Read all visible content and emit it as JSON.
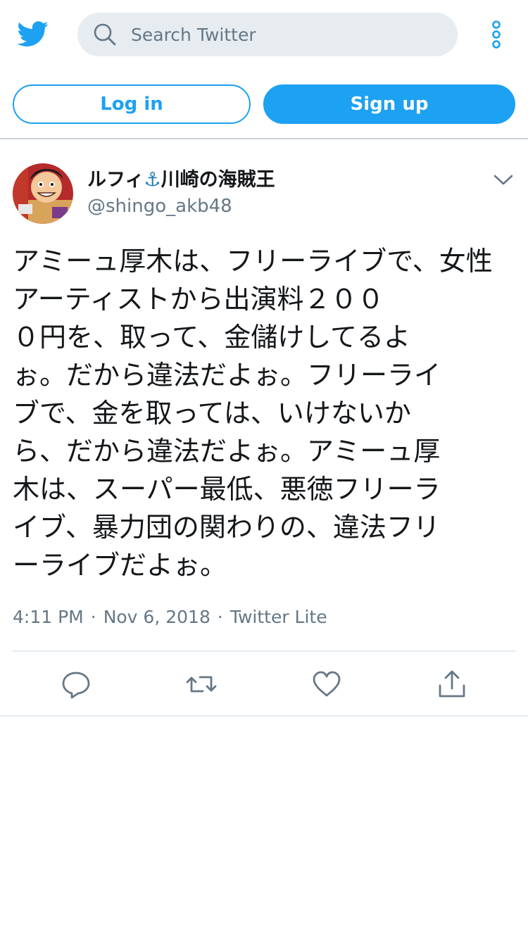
{
  "header": {
    "search_placeholder": "Search Twitter",
    "login_label": "Log in",
    "signup_label": "Sign up",
    "icons": {
      "logo": "twitter-bird-icon",
      "search": "search-icon",
      "more": "more-vertical-icon"
    }
  },
  "tweet": {
    "display_name_left": "ルフィ",
    "display_name_emoji": "⚓",
    "display_name_right": "川崎の海賊王",
    "handle": "@shingo_akb48",
    "text": "アミーュ厚木は、フリーライブで、女性アーティストから出演料２００\n０円を、取って、金儲けしてるよ\nぉ。だから違法だよぉ。フリーライ\nブで、金を取っては、いけないか\nら、だから違法だよぉ。アミーュ厚\n木は、スーパー最低、悪徳フリーラ\nイブ、暴力団の関わりの、違法フリ\nーライブだよぉ。",
    "time": "4:11 PM",
    "date": "Nov 6, 2018",
    "source": "Twitter Lite",
    "separator": "·"
  },
  "actions": {
    "icons": [
      "reply-icon",
      "retweet-icon",
      "like-icon",
      "share-icon"
    ]
  },
  "colors": {
    "brand": "#1da1f2",
    "secondary_text": "#657786",
    "search_bg": "#e6ecf0",
    "primary_text": "#14171a"
  }
}
